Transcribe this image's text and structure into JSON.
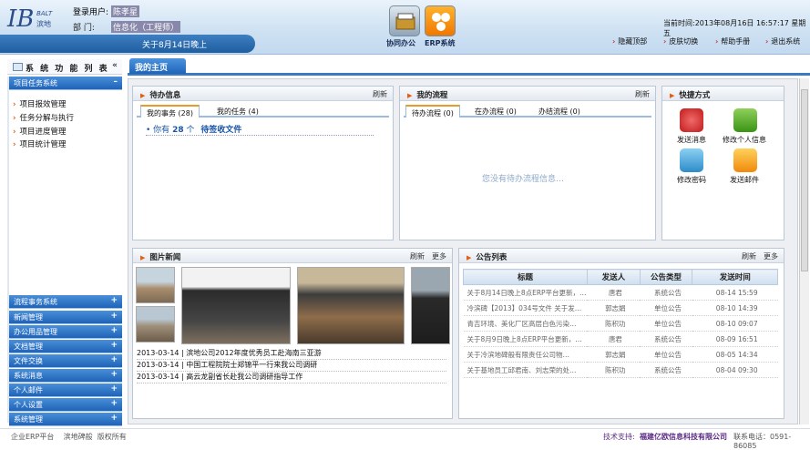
{
  "header": {
    "logo_text": "BALT 滨地",
    "user_label": "登录用户:",
    "user_name": "陈孝星",
    "dept_label": "部    门:",
    "dept_name": "信息化（工程师）",
    "marquee": "关于8月14日晚上",
    "app_oa": "协同办公",
    "app_erp": "ERP系统",
    "time_label": "当前时间:",
    "time_value": "2013年08月16日 16:57:17 星期五",
    "links": [
      "隐藏顶部",
      "皮肤切换",
      "帮助手册",
      "退出系统"
    ]
  },
  "sidebar": {
    "title": "系 统 功 能 列 表",
    "collapse_icon": "«",
    "active_category": "项目任务系统",
    "sub_items": [
      "项目报效管理",
      "任务分解与执行",
      "项目进度管理",
      "项目统计管理"
    ],
    "categories": [
      "流程事务系统",
      "新闻管理",
      "办公用品管理",
      "文档管理",
      "文件交换",
      "系统消息",
      "个人邮件",
      "个人设置",
      "系统管理"
    ]
  },
  "tabs": {
    "home": "我的主页"
  },
  "todo": {
    "title": "待办信息",
    "refresh": "刷新",
    "tabs": [
      "我的事务 (28)",
      "我的任务 (4)"
    ],
    "message_prefix": "你有",
    "message_count": "28",
    "message_unit": "个",
    "message_link": "待签收文件"
  },
  "flow": {
    "title": "我的流程",
    "refresh": "刷新",
    "tabs": [
      "待办流程 (0)",
      "在办流程 (0)",
      "办结流程 (0)"
    ],
    "empty": "您没有待办流程信息…"
  },
  "shortcuts": {
    "title": "快捷方式",
    "items": [
      "发送消息",
      "修改个人信息",
      "修改密码",
      "发送邮件"
    ]
  },
  "photo_news": {
    "title": "图片新闻",
    "refresh": "刷新",
    "more": "更多",
    "items": [
      {
        "date": "2013-03-14",
        "title": "滨地公司2012年度优秀员工赴海南三亚游"
      },
      {
        "date": "2013-03-14",
        "title": "中国工程院院士郑锦平一行来我公司调研"
      },
      {
        "date": "2013-03-14",
        "title": "高云龙副省长赴我公司调研指导工作"
      }
    ]
  },
  "notices": {
    "title": "公告列表",
    "refresh": "刷新",
    "more": "更多",
    "columns": [
      "标题",
      "发送人",
      "公告类型",
      "发送时间"
    ],
    "rows": [
      [
        "关于8月14日晚上8点ERP平台更新，…",
        "唐君",
        "系统公告",
        "08-14 15:59"
      ],
      [
        "冷滨碑【2013】034号文件 关于发…",
        "郭志娟",
        "单位公告",
        "08-10 14:39"
      ],
      [
        "青吉环境、美化厂区高层白色污染…",
        "陈积功",
        "单位公告",
        "08-10 09:07"
      ],
      [
        "关于8月9日晚上8点ERP平台更新，…",
        "唐君",
        "系统公告",
        "08-09 16:51"
      ],
      [
        "关于冷滨地碑般有限责任公司物…",
        "郭志娟",
        "单位公告",
        "08-05 14:34"
      ],
      [
        "关于基地员工邱君南、刘志荣的处…",
        "陈积功",
        "系统公告",
        "08-04 09:30"
      ]
    ]
  },
  "footer": {
    "left": "企业ERP平台    滨地碑般  版权所有",
    "support_label": "技术支持:",
    "support_name": "福建亿欧信息科技有限公司",
    "phone": "联系电话：0591-86085"
  },
  "colors": {
    "accent_blue": "#1f63b8",
    "orange": "#e35d10",
    "footer_purple": "#5b2a86"
  }
}
